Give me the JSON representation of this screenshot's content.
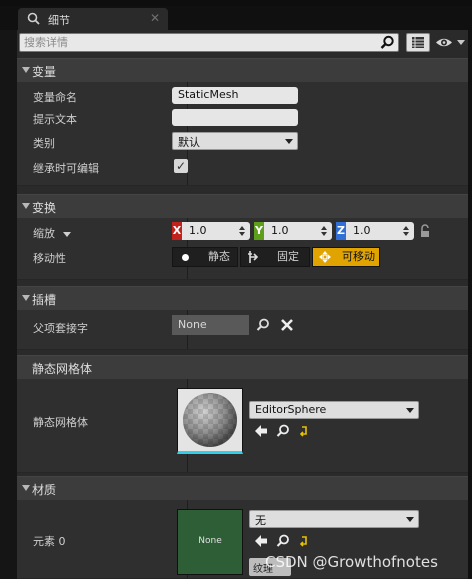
{
  "tab": {
    "title": "细节"
  },
  "search": {
    "placeholder": "搜索详情"
  },
  "sections": {
    "variables": "变量",
    "transform": "变换",
    "sockets": "插槽",
    "static_mesh": "静态网格体",
    "materials": "材质"
  },
  "variables": {
    "name_label": "变量命名",
    "name_value": "StaticMesh",
    "tooltip_label": "提示文本",
    "tooltip_value": "",
    "category_label": "类别",
    "category_value": "默认",
    "editable_label": "继承时可编辑",
    "editable_checked": true
  },
  "transform": {
    "scale_label": "缩放",
    "scale": {
      "x": "1.0",
      "y": "1.0",
      "z": "1.0"
    },
    "axis_labels": {
      "x": "X",
      "y": "Y",
      "z": "Z"
    },
    "mobility_label": "移动性",
    "mobility_options": [
      "静态",
      "固定",
      "可移动"
    ],
    "mobility_selected": "可移动"
  },
  "sockets": {
    "parent_socket_label": "父项套接字",
    "parent_socket_value": "None"
  },
  "static_mesh": {
    "label": "静态网格体",
    "value": "EditorSphere"
  },
  "materials": {
    "element_label": "元素 0",
    "thumb_label": "None",
    "value": "无",
    "texture_button": "纹理"
  },
  "watermark": "CSDN @Growthofnotes",
  "colors": {
    "axis_x": "#c2221e",
    "axis_y": "#5d9e1a",
    "axis_z": "#2f6fd6",
    "mobility_active": "#e0a300",
    "material_thumb": "#2e5e36",
    "mesh_underline": "#2fd0e8"
  }
}
